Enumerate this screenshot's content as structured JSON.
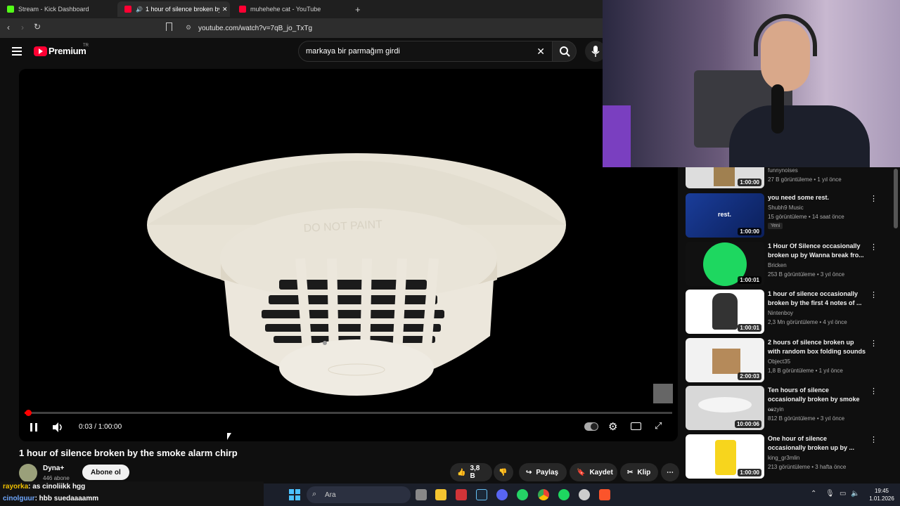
{
  "browser": {
    "tabs": [
      {
        "label": "Stream - Kick Dashboard",
        "color": "#53fc18"
      },
      {
        "label": "1 hour of silence broken by th",
        "color": "#ff0033"
      },
      {
        "label": "muhehehe cat - YouTube",
        "color": "#ff0033"
      }
    ],
    "new_tab": "+",
    "url": "youtube.com/watch?v=7qB_jo_TxTg"
  },
  "youtube": {
    "logo": "Premium",
    "region": "TR",
    "search_value": "markaya bir parmağım girdi"
  },
  "player": {
    "time": "0:03 / 1:00:00",
    "progress_fraction": 0.00083,
    "smoke_detector_text": "DO NOT PAINT"
  },
  "video": {
    "title": "1 hour of silence broken by the smoke alarm chirp",
    "channel": "Dyna+",
    "subscribers": "446 abone",
    "subscribe": "Abone ol",
    "likes": "3,8 B",
    "share": "Paylaş",
    "save": "Kaydet",
    "clip": "Klip"
  },
  "sidebar": [
    {
      "title": "",
      "channel": "funnynoises",
      "meta": "27 B görüntüleme • 1 yıl önce",
      "duration": "1:00:00",
      "badge": ""
    },
    {
      "title": "you need some rest.",
      "channel": "Shubh9 Music",
      "meta": "15 görüntüleme • 14 saat önce",
      "duration": "1:00:00",
      "badge": "Yeni",
      "thumb_text": "rest."
    },
    {
      "title": "1 Hour Of Silence occasionally broken up by Wanna break fro...",
      "channel": "Bricken",
      "meta": "253 B görüntüleme • 3 yıl önce",
      "duration": "1:00:01",
      "badge": ""
    },
    {
      "title": "1 hour of silence occasionally broken by the first 4 notes of ...",
      "channel": "Nintenboy",
      "meta": "2,3 Mn görüntüleme • 4 yıl önce",
      "duration": "1:00:01",
      "badge": ""
    },
    {
      "title": "2 hours of silence broken up with random box folding sounds",
      "channel": "Object35",
      "meta": "1,8 B görüntüleme • 1 yıl önce",
      "duration": "2:00:03",
      "badge": ""
    },
    {
      "title": "Ten hours of silence occasionally broken by smoke ...",
      "channel": "cozyin",
      "meta": "812 B görüntüleme • 3 yıl önce",
      "duration": "10:00:06",
      "badge": ""
    },
    {
      "title": "One hour of silence occasionally broken up by ...",
      "channel": "king_gr3mlin",
      "meta": "213 görüntüleme • 3 hafta önce",
      "duration": "1:00:00",
      "badge": ""
    }
  ],
  "chat": [
    {
      "user": "rayorka",
      "text": ": as cinoliikk hgg",
      "color": "#f0c000"
    },
    {
      "user": "cinolguur",
      "text": ": hbb suedaaaamm",
      "color": "#6fa8ff"
    }
  ],
  "taskbar": {
    "search": "Ara",
    "time": "19:45",
    "date": "1.01.2026"
  }
}
